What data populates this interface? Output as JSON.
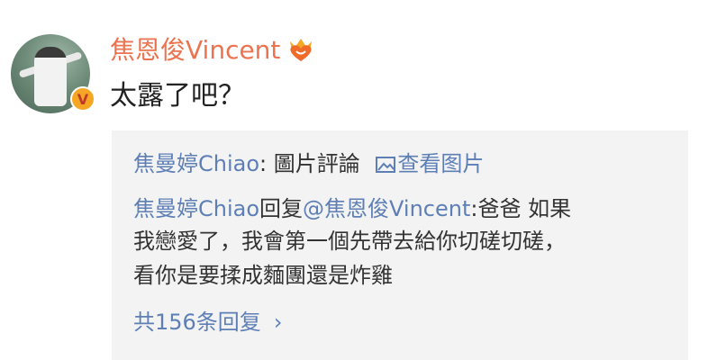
{
  "comment": {
    "username": "焦恩俊Vincent",
    "text": "太露了吧？"
  },
  "reply_box": {
    "header_user": "焦曼婷Chiao",
    "header_suffix": ": 圖片評論",
    "view_image_label": "查看图片",
    "reply_user": "焦曼婷Chiao",
    "reply_verb": "回复",
    "reply_mention": "@焦恩俊Vincent",
    "reply_colon": ":",
    "reply_text_line1": "爸爸 如果",
    "reply_text_line2": "我戀愛了，我會第一個先帶去給你切磋切磋，",
    "reply_text_line3": "看你是要揉成麵團還是炸雞",
    "more_replies_label": "共156条回复"
  },
  "colors": {
    "username": "#eb7350",
    "link": "#5d7fb6",
    "reply_background": "#f3f3f3",
    "text": "#222222"
  },
  "icons": {
    "avatar": "avatar-photo",
    "verified": "verified-badge-icon",
    "vip": "vip-heart-crown-icon",
    "image": "image-icon",
    "chevron": "chevron-right-icon"
  }
}
